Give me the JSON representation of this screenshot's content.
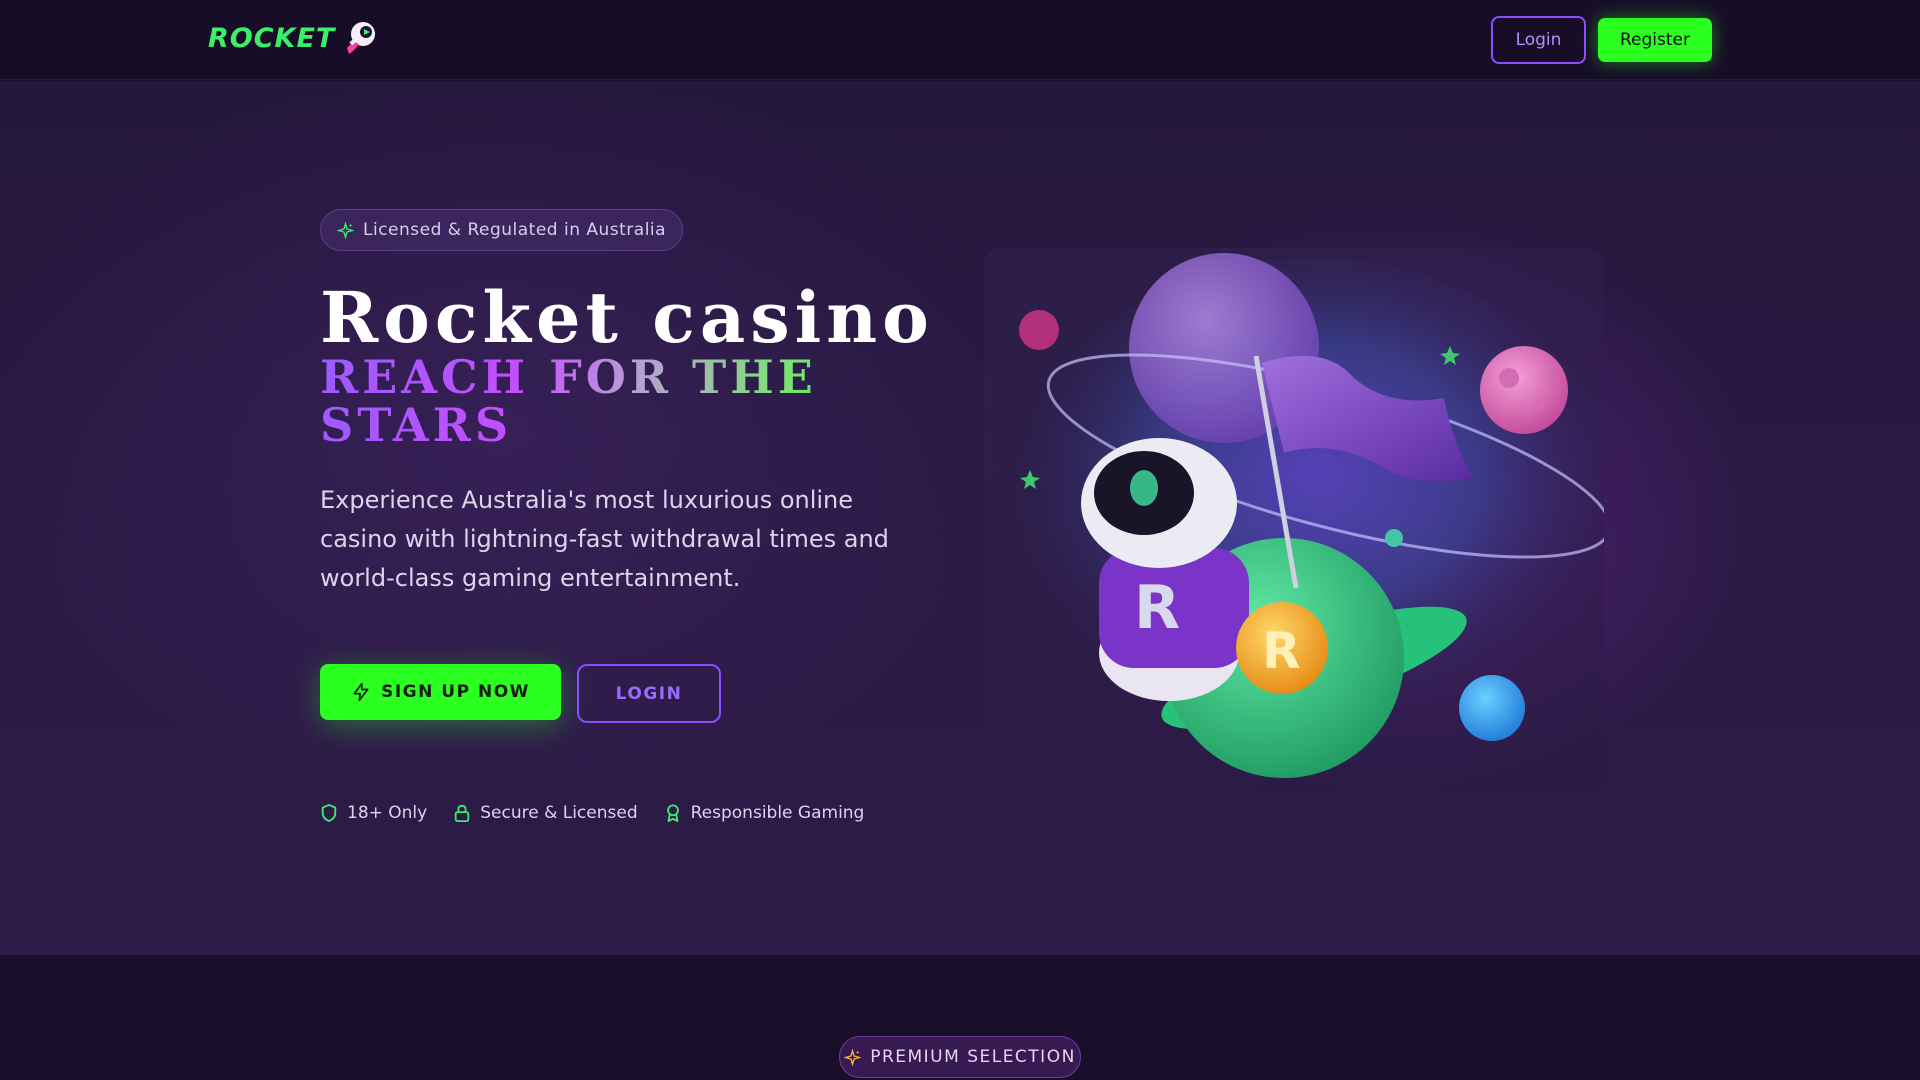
{
  "header": {
    "logo_text": "ROCKET",
    "login_label": "Login",
    "register_label": "Register"
  },
  "hero": {
    "badge": "Licensed & Regulated in Australia",
    "title": "Rocket casino",
    "tagline": "REACH FOR THE STARS",
    "description": "Experience Australia's most luxurious online casino with lightning-fast withdrawal times and world-class gaming entertainment.",
    "signup_label": "SIGN UP NOW",
    "login_label": "LOGIN",
    "trust": [
      {
        "icon": "shield-icon",
        "label": "18+ Only"
      },
      {
        "icon": "lock-icon",
        "label": "Secure & Licensed"
      },
      {
        "icon": "award-icon",
        "label": "Responsible Gaming"
      }
    ]
  },
  "section2": {
    "badge": "PREMIUM SELECTION"
  },
  "colors": {
    "accent_green": "#2bff1f",
    "accent_purple": "#8a4dff",
    "background": "#1a0f2b"
  }
}
